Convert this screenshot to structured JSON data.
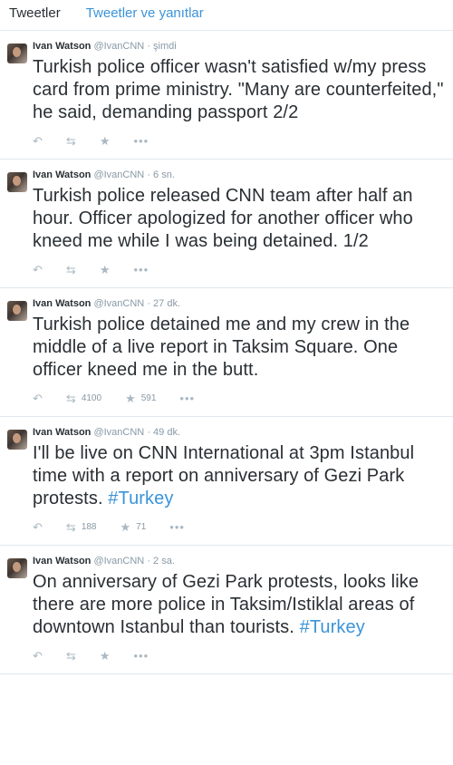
{
  "tabs": [
    {
      "label": "Tweetler",
      "active": true
    },
    {
      "label": "Tweetler ve yanıtlar",
      "active": false
    }
  ],
  "accent_color": "#3b94d9",
  "tweets": [
    {
      "name": "Ivan Watson",
      "handle": "@IvanCNN",
      "time": "şimdi",
      "text": "Turkish police officer wasn't satisfied w/my press card from prime ministry. \"Many are counterfeited,\" he said, demanding passport 2/2",
      "hashtag": "",
      "retweets": "",
      "favorites": ""
    },
    {
      "name": "Ivan Watson",
      "handle": "@IvanCNN",
      "time": "6 sn.",
      "text": "Turkish police released CNN team after half an hour. Officer apologized for another officer who kneed me while I was being detained. 1/2",
      "hashtag": "",
      "retweets": "",
      "favorites": ""
    },
    {
      "name": "Ivan Watson",
      "handle": "@IvanCNN",
      "time": "27 dk.",
      "text": "Turkish police detained me and my crew in the middle of a live report in Taksim Square. One officer kneed me in the butt.",
      "hashtag": "",
      "retweets": "4100",
      "favorites": "591"
    },
    {
      "name": "Ivan Watson",
      "handle": "@IvanCNN",
      "time": "49 dk.",
      "text": "I'll be live on CNN International at 3pm Istanbul time with a report on anniversary of Gezi Park protests.",
      "hashtag": "#Turkey",
      "retweets": "188",
      "favorites": "71"
    },
    {
      "name": "Ivan Watson",
      "handle": "@IvanCNN",
      "time": "2 sa.",
      "text": "On anniversary of Gezi Park protests, looks like there are more police in Taksim/Istiklal areas of downtown Istanbul than tourists.",
      "hashtag": "#Turkey",
      "retweets": "",
      "favorites": ""
    }
  ],
  "icons": {
    "reply": "reply-icon",
    "retweet": "retweet-icon",
    "favorite": "star-icon",
    "more": "more-icon"
  }
}
